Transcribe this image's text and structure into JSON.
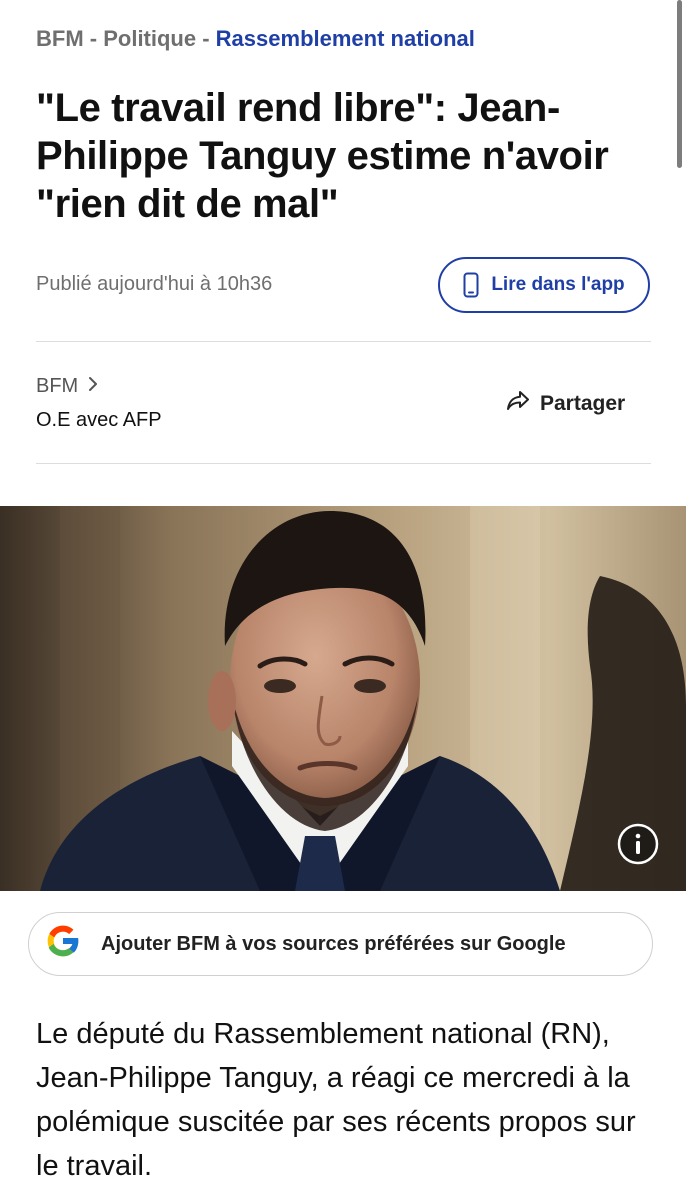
{
  "breadcrumb": {
    "site": "BFM",
    "separator_1": " - ",
    "section": "Politique",
    "separator_2": " - ",
    "topic": "Rassemblement national"
  },
  "article": {
    "title": "\"Le travail rend libre\": Jean-Philippe Tanguy estime n'avoir \"rien dit de mal\"",
    "published": "Publié aujourd'hui à 10h36",
    "source": "BFM",
    "author": "O.E avec AFP",
    "lead": "Le député du Rassemblement national (RN), Jean-Philippe Tanguy, a réagi ce mercredi à la polémique suscitée par ses récents propos sur le travail."
  },
  "actions": {
    "read_in_app_label": "Lire dans l'app",
    "share_label": "Partager",
    "google_sources_label": "Ajouter BFM à vos sources préférées sur Google"
  },
  "icons": {
    "app": "phone-icon",
    "source_chevron": "chevron-right-icon",
    "share": "share-arrow-icon",
    "photo_info": "info-icon",
    "google": "google-logo-icon"
  },
  "colors": {
    "accent": "#1f3fa6",
    "muted_text": "#6f6f6f",
    "body_text": "#111111",
    "divider": "#dddddd"
  }
}
